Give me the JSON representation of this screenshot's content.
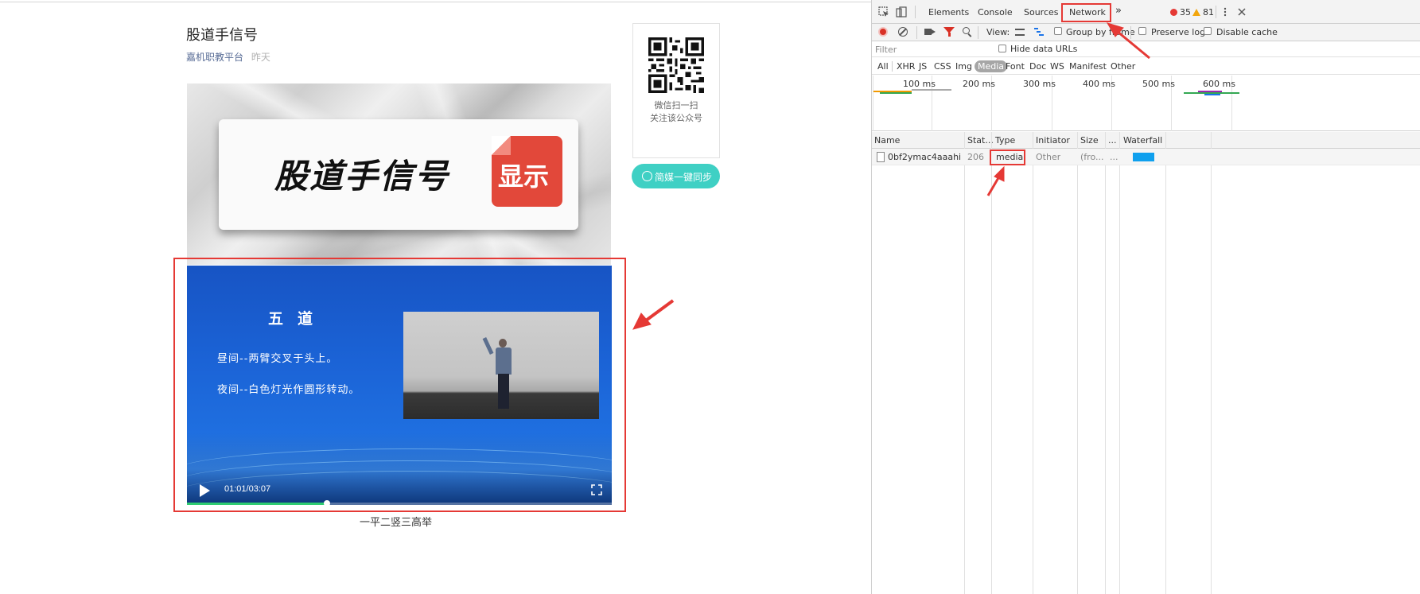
{
  "article": {
    "title": "股道手信号",
    "account": "嘉机职教平台",
    "date": "昨天",
    "cover_text": "股道手信号",
    "cover_badge": "显示",
    "caption": "一平二竖三高举"
  },
  "video": {
    "heading": "五道",
    "line1": "昼间--两臂交叉于头上。",
    "line2": "夜间--白色灯光作圆形转动。",
    "time": "01:01/03:07",
    "progress": 0.33
  },
  "sidebar": {
    "qr_line1": "微信扫一扫",
    "qr_line2": "关注该公众号",
    "sync_button": "简媒一键同步"
  },
  "devtools": {
    "tabs": [
      "Elements",
      "Console",
      "Sources",
      "Network"
    ],
    "active_tab": "Network",
    "more_tabs": "»",
    "errors": "35",
    "warnings": "81",
    "toolbar": {
      "view_label": "View:",
      "group_by_frame": "Group by frame",
      "preserve_log": "Preserve log",
      "disable_cache": "Disable cache"
    },
    "filter_placeholder": "Filter",
    "hide_data_urls": "Hide data URLs",
    "types": [
      "All",
      "XHR",
      "JS",
      "CSS",
      "Img",
      "Media",
      "Font",
      "Doc",
      "WS",
      "Manifest",
      "Other"
    ],
    "active_type": "Media",
    "timeline_ticks": [
      "100 ms",
      "200 ms",
      "300 ms",
      "400 ms",
      "500 ms",
      "600 ms"
    ],
    "columns": [
      "Name",
      "Stat...",
      "Type",
      "Initiator",
      "Size",
      "...",
      "Waterfall"
    ],
    "rows": [
      {
        "name": "0bf2ymac4aaahia...",
        "status": "206",
        "type": "media",
        "initiator": "Other",
        "size": "(fro...",
        "time": "..."
      }
    ]
  },
  "colors": {
    "annotation_red": "#e53935",
    "link_blue": "#576b95",
    "sync_teal": "#3fd0c4",
    "video_blue": "#1b63d6",
    "waterfall_bar": "#0fa0ee"
  }
}
